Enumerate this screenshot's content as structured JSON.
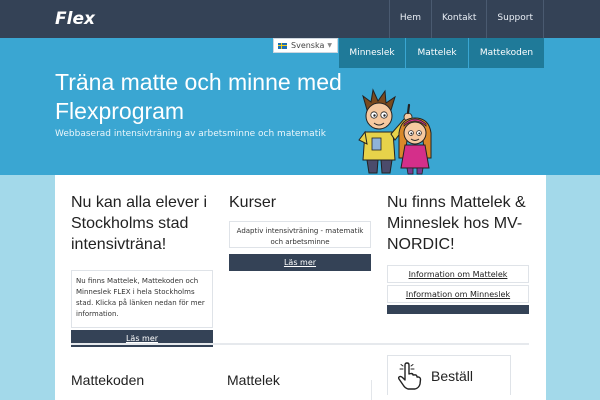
{
  "header": {
    "logo_text": "Flex",
    "nav": [
      "Hem",
      "Kontakt",
      "Support"
    ]
  },
  "hero": {
    "language": "Svenska",
    "subnav": [
      "Minneslek",
      "Mattelek",
      "Mattekoden"
    ],
    "title": "Träna matte och minne med Flexprogram",
    "tagline": "Webbaserad intensivträning av arbetsminne och matematik"
  },
  "columns": {
    "stockholm": {
      "title": "Nu kan alla elever i Stockholms stad intensivträna!",
      "body": "Nu finns Mattelek, Mattekoden och Minneslek FLEX i hela Stockholms stad. Klicka på länken nedan för mer information.",
      "button": "Läs mer"
    },
    "kurser": {
      "title": "Kurser",
      "body": "Adaptiv intensivträning - matematik och arbetsminne",
      "button": "Läs mer"
    },
    "mvnordic": {
      "title": "Nu finns Mattelek & Minneslek hos MV-NORDIC!",
      "links": [
        "Information om Mattelek",
        "Information om Minneslek"
      ]
    }
  },
  "lower": {
    "mattekoden": "Mattekoden",
    "mattelek": "Mattelek",
    "bestall": "Beställ"
  },
  "colors": {
    "navbar": "#344256",
    "hero": "#3aa6d2",
    "subnav": "#1f7a99",
    "page_bg": "#a3d9ea"
  }
}
